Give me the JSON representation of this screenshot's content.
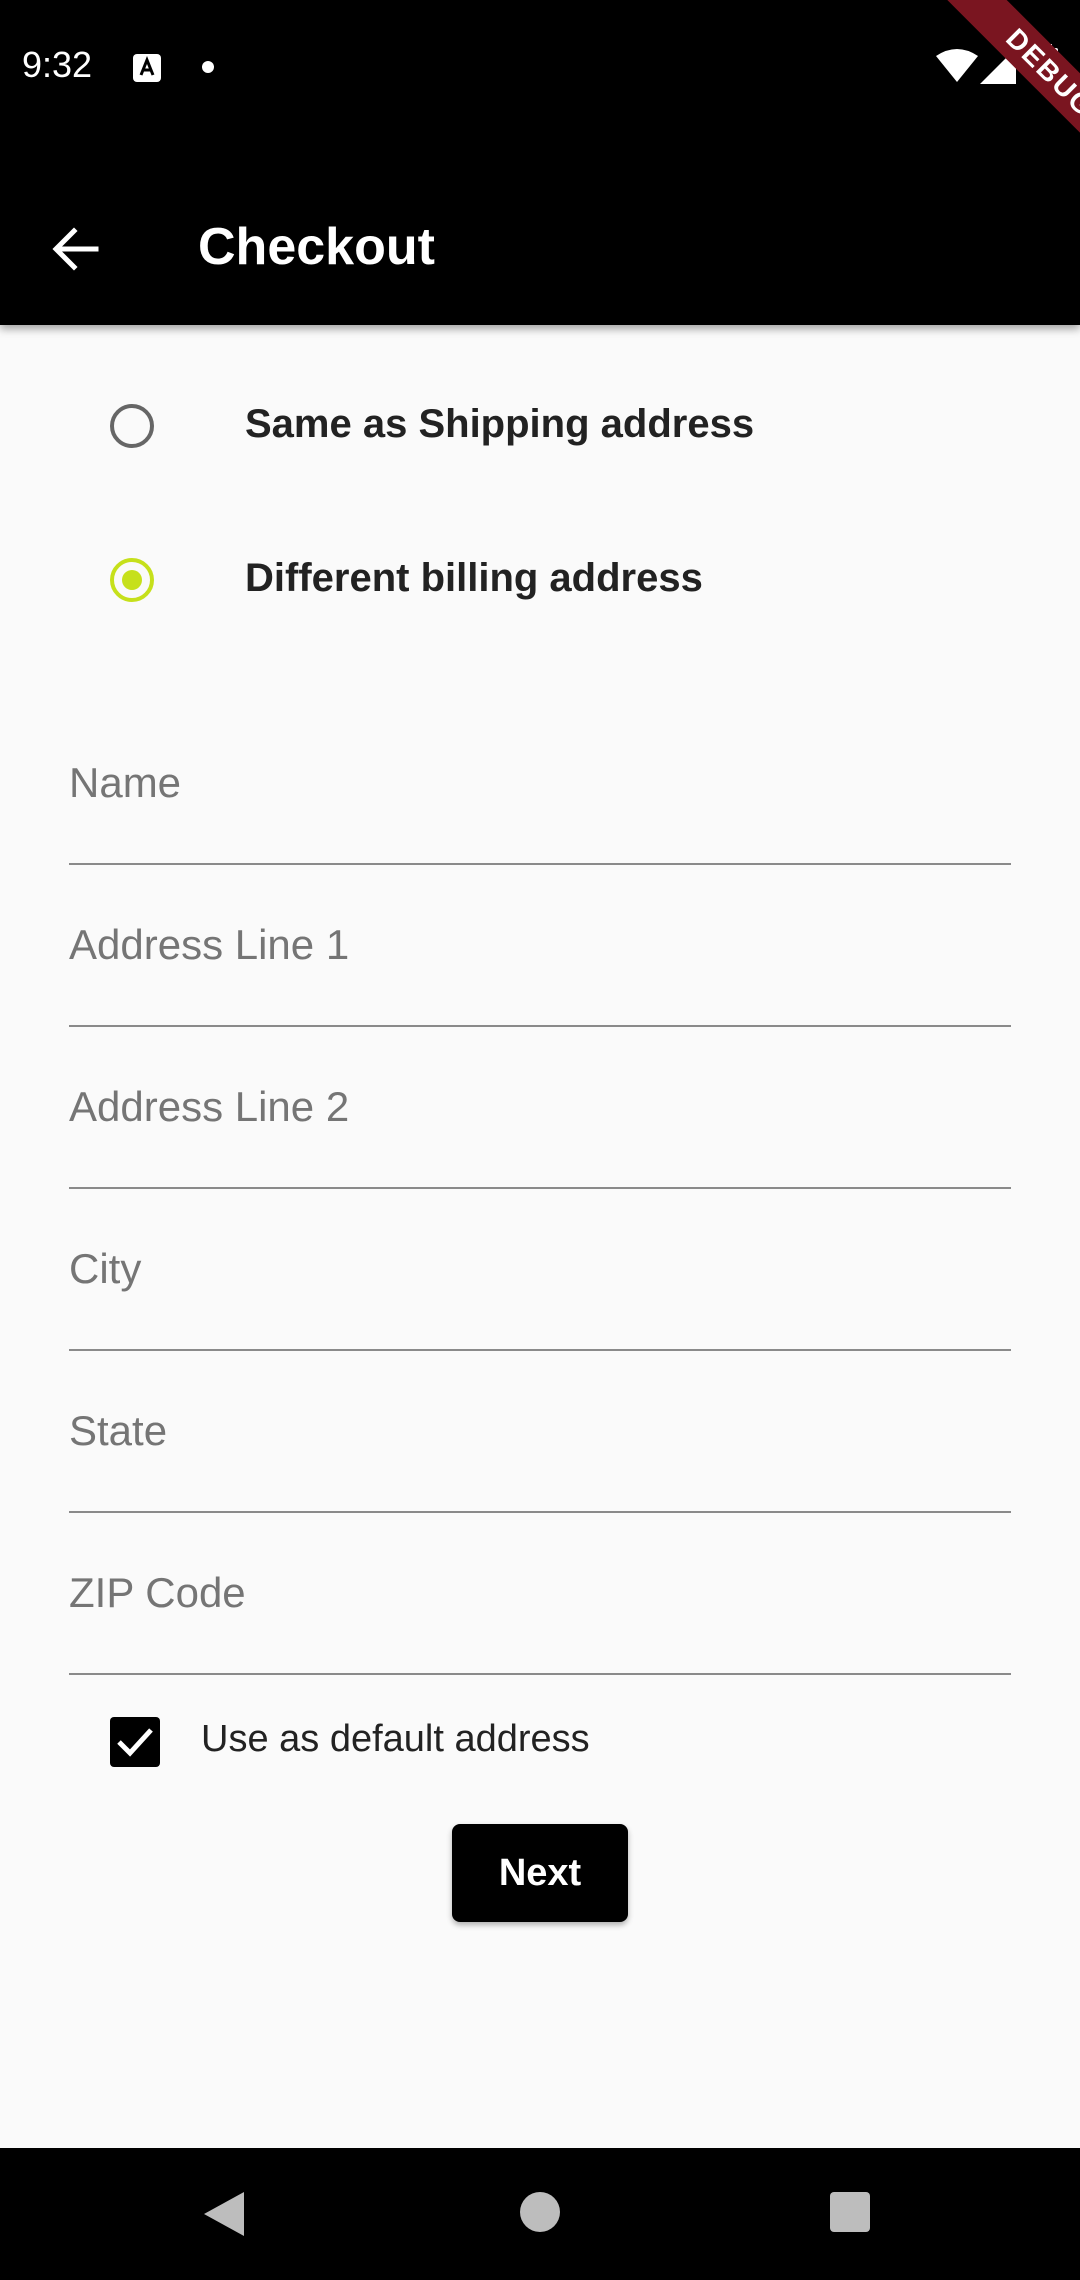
{
  "status_bar": {
    "time": "9:32",
    "debug_banner": "DEBUG"
  },
  "app_bar": {
    "title": "Checkout"
  },
  "billing_options": [
    {
      "label": "Same as Shipping address",
      "selected": false
    },
    {
      "label": "Different billing address",
      "selected": true
    }
  ],
  "form": {
    "name_placeholder": "Name",
    "address1_placeholder": "Address Line 1",
    "address2_placeholder": "Address Line 2",
    "city_placeholder": "City",
    "state_placeholder": "State",
    "zip_placeholder": "ZIP Code"
  },
  "default_address": {
    "label": "Use as default address",
    "checked": true
  },
  "next_label": "Next",
  "colors": {
    "accent": "#c6e01b",
    "app_bar": "#000000",
    "background": "#fafafa",
    "debug_banner": "#7a1520"
  },
  "icons": [
    "back-arrow-icon",
    "wifi-icon",
    "signal-icon",
    "battery-icon",
    "check-icon",
    "nav-back-icon",
    "nav-home-icon",
    "nav-recents-icon"
  ]
}
